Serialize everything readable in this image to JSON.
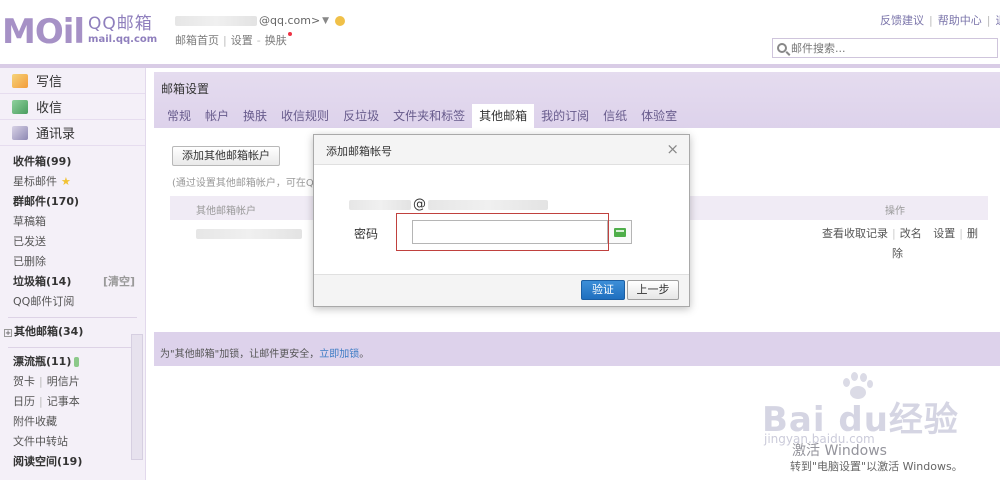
{
  "header": {
    "logo_mark": "MOil",
    "logo_title": "QQ邮箱",
    "logo_subtitle": "mail.qq.com",
    "account_domain": "@qq.com>",
    "account_arrow": "▼",
    "toplinks": [
      "邮箱首页",
      "设置",
      "换肤"
    ],
    "rightlinks": [
      "反馈建议",
      "帮助中心",
      "退"
    ],
    "search_placeholder": "邮件搜索..."
  },
  "sidebar": {
    "quick": [
      {
        "label": "写信",
        "icon": "compose-icon"
      },
      {
        "label": "收信",
        "icon": "inbox-icon"
      },
      {
        "label": "通讯录",
        "icon": "contacts-icon"
      }
    ],
    "inbox": "收件箱(99)",
    "starred": "星标邮件",
    "group": "群邮件(170)",
    "drafts": "草稿箱",
    "sent": "已发送",
    "deleted": "已删除",
    "trash": "垃圾箱(14)",
    "trash_clear": "[清空]",
    "qq_subscribe": "QQ邮件订阅",
    "other_mailbox": "其他邮箱(34)",
    "drift_bottle": "漂流瓶(11)",
    "card": "贺卡",
    "postcard": "明信片",
    "calendar": "日历",
    "notepad": "记事本",
    "attachments": "附件收藏",
    "file_transfer": "文件中转站",
    "reading_space": "阅读空间(19)"
  },
  "main": {
    "title": "邮箱设置",
    "tabs": [
      "常规",
      "帐户",
      "换肤",
      "收信规则",
      "反垃圾",
      "文件夹和标签",
      "其他邮箱",
      "我的订阅",
      "信纸",
      "体验室"
    ],
    "active_tab": "其他邮箱",
    "add_button": "添加其他邮箱帐户",
    "add_hint": "(通过设置其他邮箱帐户，可在Q",
    "col_account": "其他邮箱帐户",
    "col_ops": "操作",
    "row_ops": [
      "查看收取记录",
      "改名",
      "设置",
      "删"
    ],
    "row_ops_wrap": "除",
    "security_text": "为\"其他邮箱\"加锁，让邮件更安全，",
    "security_link": "立即加锁",
    "security_end": "。"
  },
  "dialog": {
    "title": "添加邮箱帐号",
    "close": "×",
    "at": "@",
    "password_label": "密码",
    "password_value": "",
    "verify_button": "验证",
    "prev_button": "上一步"
  },
  "watermark": {
    "baidu_text": "Bai du经验",
    "jingyan_url": "jingyan.baidu.com",
    "win_activate": "激活 Windows",
    "win_activate_sub": "转到\"电脑设置\"以激活 Windows。"
  },
  "colors": {
    "accent": "#a691c6",
    "panel": "#ddd2eb",
    "link": "#3b7bc4",
    "verify": "#2b7ccb",
    "highlight": "#c0413e"
  }
}
